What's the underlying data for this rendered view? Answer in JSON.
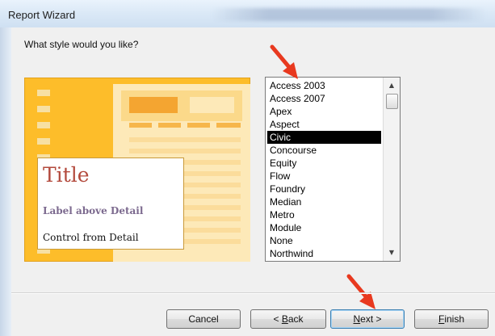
{
  "window": {
    "title": "Report Wizard"
  },
  "prompt": "What style would you like?",
  "preview": {
    "title": "Title",
    "label_above": "Label above Detail",
    "control_detail": "Control from Detail"
  },
  "styles": {
    "items": [
      "Access 2003",
      "Access 2007",
      "Apex",
      "Aspect",
      "Civic",
      "Concourse",
      "Equity",
      "Flow",
      "Foundry",
      "Median",
      "Metro",
      "Module",
      "None",
      "Northwind"
    ],
    "selected": "Civic"
  },
  "buttons": {
    "cancel": "Cancel",
    "back_pre": "< ",
    "back_key": "B",
    "back_post": "ack",
    "next_key": "N",
    "next_post": "ext >",
    "finish_key": "F",
    "finish_post": "inish"
  },
  "colors": {
    "annotation_arrow": "#e8391f",
    "preview_accent": "#fdbd2a",
    "selection": "#000000"
  },
  "icons": {
    "scroll_up": "triangle-up-icon",
    "scroll_down": "triangle-down-icon",
    "annotation": "red-arrow-icon"
  }
}
